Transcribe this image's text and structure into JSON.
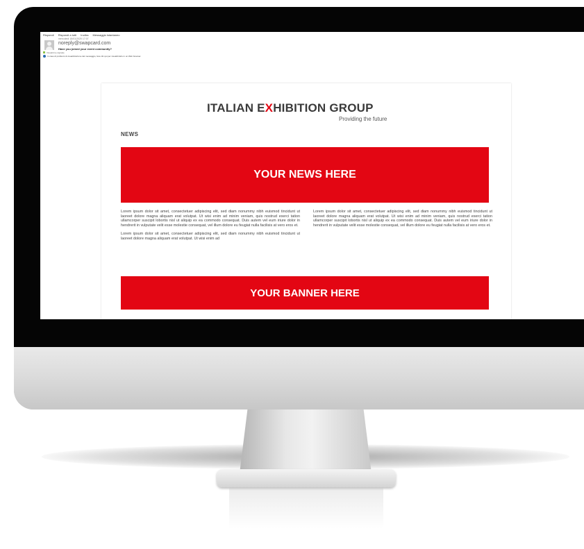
{
  "mail": {
    "toolbar": [
      "Rispondi",
      "Rispondi a tutti",
      "Inoltra",
      "Messaggio istantaneo"
    ],
    "date": "mercoledì 15/01/2020 17:07",
    "from": "noreply@swapcard.com",
    "subject": "Have you joined your event community?",
    "attachment": "Visualizza originale",
    "info": "In caso di problemi di visualizzazione del messaggio, fare clic qui per visualizzarlo in un Web browser."
  },
  "newsletter": {
    "logo": {
      "part1": "ITALIAN E",
      "highlight": "X",
      "part2": "HIBITION GROUP"
    },
    "tagline": "Providing the future",
    "news_label": "NEWS",
    "news_banner": "YOUR NEWS HERE",
    "left_column": [
      "Lorem ipsum dolor sit amet, consectetuer adipiscing elit, sed diam nonummy nibh euismod tincidunt ut laoreet dolore magna aliquam erat volutpat. Ut wisi enim ad minim veniam, quis nostrud exerci tation ullamcorper suscipit lobortis nisl ut aliquip ex ea commodo consequat. Duis autem vel eum iriure dolor in hendrerit in vulputate velit esse molestie consequat, vel illum dolore eu feugiat nulla facilisis at vero eros et.",
      "Lorem ipsum dolor sit amet, consectetuer adipiscing elit, sed diam nonummy nibh euismod tincidunt ut laoreet dolore magna aliquam erat volutpat. Ut wisi enim ad"
    ],
    "right_column": [
      "Lorem ipsum dolor sit amet, consectetuer adipiscing elit, sed diam nonummy nibh euismod tincidunt ut laoreet dolore magna aliquam erat volutpat. Ut wisi enim ad minim veniam, quis nostrud exerci tation ullamcorper suscipit lobortis nisl ut aliquip ex ea commodo consequat. Duis autem vel eum iriure dolor in hendrerit in vulputate velit esse molestie consequat, vel illum dolore eu feugiat nulla facilisis at vero eros et."
    ],
    "banner": "YOUR BANNER HERE"
  },
  "colors": {
    "brand_red": "#e30613",
    "text_dark": "#3a3a3a"
  },
  "icons": [
    "reply-icon",
    "reply-all-icon",
    "forward-icon",
    "chat-icon",
    "avatar-icon",
    "attachment-icon",
    "info-icon"
  ]
}
